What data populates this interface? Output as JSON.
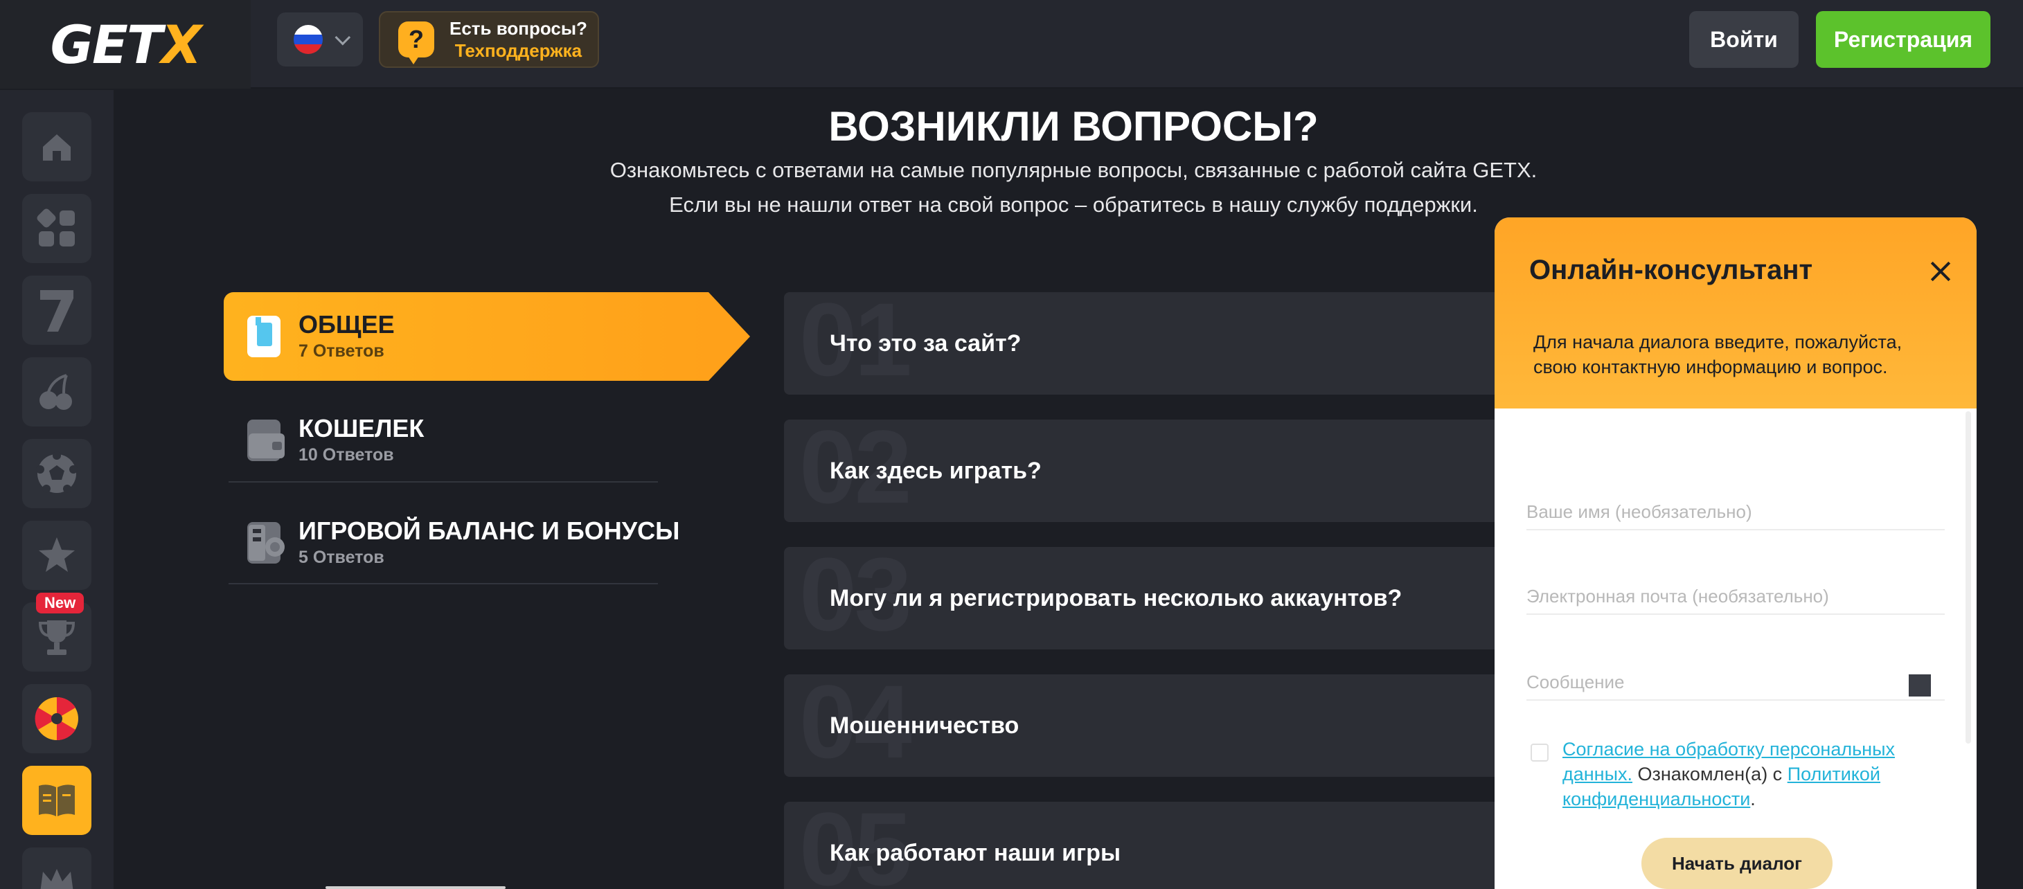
{
  "header": {
    "logo_main": "GET",
    "logo_accent": "X",
    "support_title": "Есть вопросы?",
    "support_sub": "Техподдержка",
    "support_icon": "?",
    "login_label": "Войти",
    "register_label": "Регистрация"
  },
  "sidebar": {
    "new_badge": "New",
    "items": [
      "home-icon",
      "grid-icon",
      "seven-icon",
      "cherry-icon",
      "football-icon",
      "star-icon",
      "trophy-icon",
      "wheel-icon",
      "book-icon",
      "crown-icon"
    ]
  },
  "faq": {
    "title": "ВОЗНИКЛИ ВОПРОСЫ?",
    "subtitle_1": "Ознакомьтесь с ответами на самые популярные вопросы, связанные с работой сайта GETX.",
    "subtitle_2": "Если вы не нашли ответ на свой вопрос – обратитесь в нашу службу поддержки."
  },
  "categories": [
    {
      "name": "ОБЩЕЕ",
      "count": "7 Ответов",
      "active": true
    },
    {
      "name": "КОШЕЛЕК",
      "count": "10 Ответов",
      "active": false
    },
    {
      "name": "ИГРОВОЙ БАЛАНС И БОНУСЫ",
      "count": "5 Ответов",
      "active": false
    }
  ],
  "questions": [
    {
      "num": "01",
      "text": "Что это за сайт?"
    },
    {
      "num": "02",
      "text": "Как здесь играть?"
    },
    {
      "num": "03",
      "text": "Могу ли я регистрировать несколько аккаунтов?"
    },
    {
      "num": "04",
      "text": "Мошенничество"
    },
    {
      "num": "05",
      "text": "Как работают наши игры"
    }
  ],
  "chat": {
    "title": "Онлайн-консультант",
    "description": "Для начала диалога введите, пожалуйста, свою контактную информацию и вопрос.",
    "name_placeholder": "Ваше имя (необязательно)",
    "email_placeholder": "Электронная почта (необязательно)",
    "message_placeholder": "Сообщение",
    "consent_link": "Согласие на обработку персональных данных.",
    "consent_text": " Ознакомлен(а) с ",
    "policy_link": "Политикой конфиденциальности",
    "consent_end": ".",
    "start_button": "Начать диалог"
  },
  "colors": {
    "accent": "#ffb21e",
    "register": "#5cc22c",
    "background": "#1c1e24",
    "card": "#2c2e35",
    "link": "#23b3d9"
  }
}
